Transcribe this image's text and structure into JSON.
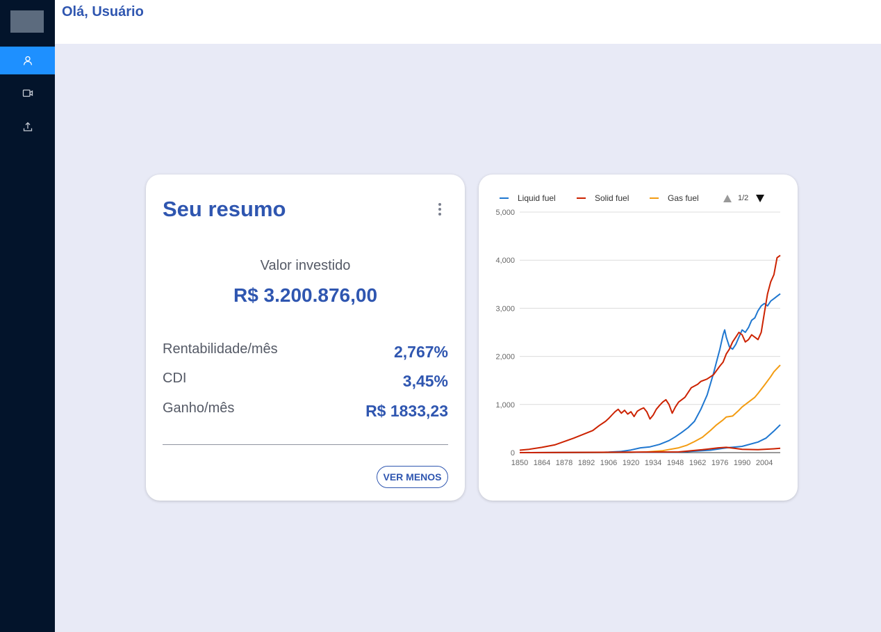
{
  "header": {
    "greeting": "Olá, Usuário"
  },
  "sidebar": {
    "items": [
      {
        "icon": "user-icon",
        "active": true
      },
      {
        "icon": "video-icon",
        "active": false
      },
      {
        "icon": "upload-icon",
        "active": false
      }
    ]
  },
  "summary": {
    "title": "Seu resumo",
    "invested_label": "Valor investido",
    "invested_value": "R$ 3.200.876,00",
    "stats": [
      {
        "label": "Rentabilidade/mês",
        "value": "2,767%"
      },
      {
        "label": "CDI",
        "value": "3,45%"
      },
      {
        "label": "Ganho/mês",
        "value": "R$ 1833,23"
      }
    ],
    "button_label": "VER MENOS"
  },
  "colors": {
    "accent": "#2f56b0",
    "sidebar_bg": "#03142b",
    "active_nav": "#1e90ff",
    "page_bg": "#e8eaf6"
  },
  "chart_data": {
    "type": "line",
    "legend": {
      "placement": "top",
      "page": "1/2"
    },
    "xlim": [
      1850,
      2014
    ],
    "ylim": [
      0,
      5000
    ],
    "y_ticks": [
      0,
      1000,
      2000,
      3000,
      4000,
      5000
    ],
    "y_tick_labels": [
      "0",
      "1,000",
      "2,000",
      "3,000",
      "4,000",
      "5,000"
    ],
    "x_ticks": [
      1850,
      1864,
      1878,
      1892,
      1906,
      1920,
      1934,
      1948,
      1962,
      1976,
      1990,
      2004
    ],
    "x_tick_labels": [
      "1850",
      "1864",
      "1878",
      "1892",
      "1906",
      "1920",
      "1934",
      "1948",
      "1962",
      "1976",
      "1990",
      "2004"
    ],
    "grid": true,
    "series": [
      {
        "name": "Liquid fuel",
        "color": "#1f77d0",
        "points": [
          [
            1850,
            0
          ],
          [
            1900,
            5
          ],
          [
            1906,
            10
          ],
          [
            1914,
            25
          ],
          [
            1920,
            55
          ],
          [
            1926,
            100
          ],
          [
            1932,
            120
          ],
          [
            1938,
            170
          ],
          [
            1944,
            250
          ],
          [
            1948,
            330
          ],
          [
            1952,
            420
          ],
          [
            1956,
            520
          ],
          [
            1960,
            650
          ],
          [
            1964,
            900
          ],
          [
            1968,
            1200
          ],
          [
            1972,
            1650
          ],
          [
            1974,
            1900
          ],
          [
            1976,
            2150
          ],
          [
            1978,
            2450
          ],
          [
            1979,
            2550
          ],
          [
            1980,
            2400
          ],
          [
            1982,
            2200
          ],
          [
            1984,
            2150
          ],
          [
            1986,
            2250
          ],
          [
            1988,
            2400
          ],
          [
            1990,
            2550
          ],
          [
            1992,
            2500
          ],
          [
            1994,
            2600
          ],
          [
            1996,
            2750
          ],
          [
            1998,
            2800
          ],
          [
            2000,
            2950
          ],
          [
            2002,
            3050
          ],
          [
            2004,
            3100
          ],
          [
            2006,
            3050
          ],
          [
            2008,
            3150
          ],
          [
            2010,
            3200
          ],
          [
            2012,
            3250
          ],
          [
            2014,
            3300
          ]
        ]
      },
      {
        "name": "Solid fuel",
        "color": "#cc2200",
        "points": [
          [
            1850,
            50
          ],
          [
            1856,
            70
          ],
          [
            1864,
            110
          ],
          [
            1872,
            160
          ],
          [
            1878,
            230
          ],
          [
            1884,
            300
          ],
          [
            1890,
            380
          ],
          [
            1896,
            460
          ],
          [
            1900,
            560
          ],
          [
            1904,
            650
          ],
          [
            1906,
            710
          ],
          [
            1908,
            780
          ],
          [
            1910,
            850
          ],
          [
            1912,
            900
          ],
          [
            1914,
            820
          ],
          [
            1916,
            880
          ],
          [
            1918,
            800
          ],
          [
            1920,
            850
          ],
          [
            1922,
            750
          ],
          [
            1924,
            860
          ],
          [
            1926,
            900
          ],
          [
            1928,
            930
          ],
          [
            1930,
            850
          ],
          [
            1932,
            700
          ],
          [
            1934,
            780
          ],
          [
            1936,
            900
          ],
          [
            1938,
            980
          ],
          [
            1940,
            1050
          ],
          [
            1942,
            1100
          ],
          [
            1944,
            1000
          ],
          [
            1946,
            820
          ],
          [
            1948,
            950
          ],
          [
            1950,
            1050
          ],
          [
            1954,
            1150
          ],
          [
            1958,
            1350
          ],
          [
            1962,
            1420
          ],
          [
            1964,
            1480
          ],
          [
            1968,
            1530
          ],
          [
            1972,
            1620
          ],
          [
            1976,
            1800
          ],
          [
            1978,
            1880
          ],
          [
            1980,
            2050
          ],
          [
            1982,
            2150
          ],
          [
            1984,
            2300
          ],
          [
            1986,
            2400
          ],
          [
            1988,
            2500
          ],
          [
            1990,
            2450
          ],
          [
            1992,
            2300
          ],
          [
            1994,
            2350
          ],
          [
            1996,
            2450
          ],
          [
            1998,
            2400
          ],
          [
            2000,
            2350
          ],
          [
            2002,
            2500
          ],
          [
            2004,
            2900
          ],
          [
            2006,
            3300
          ],
          [
            2008,
            3550
          ],
          [
            2010,
            3700
          ],
          [
            2012,
            4050
          ],
          [
            2014,
            4100
          ]
        ]
      },
      {
        "name": "Gas fuel",
        "color": "#f39c12",
        "points": [
          [
            1850,
            0
          ],
          [
            1920,
            5
          ],
          [
            1930,
            15
          ],
          [
            1940,
            40
          ],
          [
            1950,
            100
          ],
          [
            1955,
            150
          ],
          [
            1960,
            230
          ],
          [
            1965,
            320
          ],
          [
            1970,
            460
          ],
          [
            1974,
            580
          ],
          [
            1978,
            680
          ],
          [
            1980,
            740
          ],
          [
            1984,
            760
          ],
          [
            1988,
            880
          ],
          [
            1990,
            950
          ],
          [
            1994,
            1050
          ],
          [
            1998,
            1150
          ],
          [
            2000,
            1230
          ],
          [
            2004,
            1400
          ],
          [
            2008,
            1580
          ],
          [
            2010,
            1680
          ],
          [
            2014,
            1820
          ]
        ]
      },
      {
        "name": "",
        "color": "#1f77d0",
        "points": [
          [
            1850,
            0
          ],
          [
            1950,
            10
          ],
          [
            1970,
            50
          ],
          [
            1980,
            100
          ],
          [
            1990,
            130
          ],
          [
            2000,
            220
          ],
          [
            2005,
            300
          ],
          [
            2010,
            450
          ],
          [
            2014,
            580
          ]
        ]
      },
      {
        "name": "",
        "color": "#cc2200",
        "points": [
          [
            1850,
            0
          ],
          [
            1950,
            15
          ],
          [
            1965,
            60
          ],
          [
            1975,
            100
          ],
          [
            1980,
            110
          ],
          [
            1985,
            90
          ],
          [
            1990,
            70
          ],
          [
            2000,
            60
          ],
          [
            2010,
            80
          ],
          [
            2014,
            90
          ]
        ]
      }
    ]
  }
}
